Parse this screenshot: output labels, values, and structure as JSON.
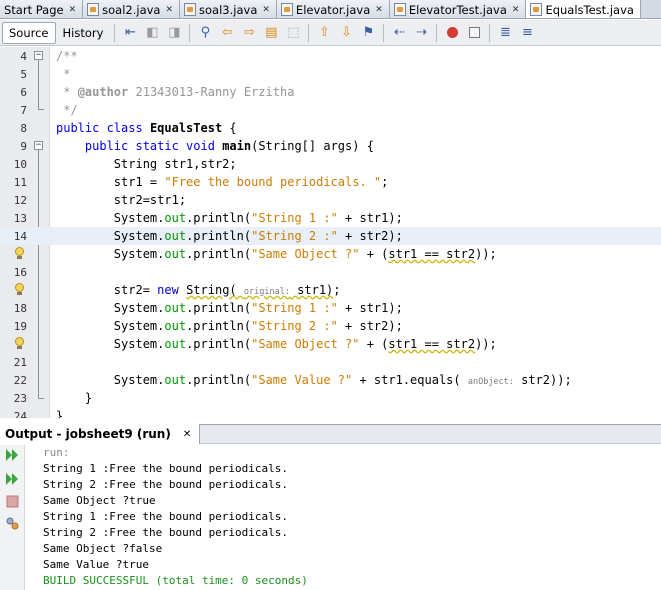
{
  "tabs": [
    {
      "label": "Start Page",
      "has_icon": false,
      "active": false
    },
    {
      "label": "soal2.java",
      "has_icon": true,
      "active": false
    },
    {
      "label": "soal3.java",
      "has_icon": true,
      "active": false
    },
    {
      "label": "Elevator.java",
      "has_icon": true,
      "active": false
    },
    {
      "label": "ElevatorTest.java",
      "has_icon": true,
      "active": false
    },
    {
      "label": "EqualsTest.java",
      "has_icon": true,
      "active": true
    }
  ],
  "toolbar": {
    "source_label": "Source",
    "history_label": "History"
  },
  "editor": {
    "line_numbers": [
      "4",
      "5",
      "6",
      "7",
      "8",
      "9",
      "10",
      "11",
      "12",
      "13",
      "14",
      "15",
      "16",
      "17",
      "18",
      "19",
      "20",
      "21",
      "22",
      "23",
      "24"
    ],
    "author_tag": "@author",
    "author_value": " 21343013-Ranny Erzitha",
    "strings": {
      "free": "\"Free the bound periodicals. \"",
      "s1": "\"String 1 :\"",
      "s2": "\"String 2 :\"",
      "same_obj": "\"Same Object ?\"",
      "same_val": "\"Same Value ?\""
    },
    "param_hints": {
      "original": "original:",
      "anObject": "anObject:"
    }
  },
  "output": {
    "tab_label": "Output - jobsheet9 (run)",
    "lines": [
      "run:",
      "String 1 :Free the bound periodicals.",
      "String 2 :Free the bound periodicals.",
      "Same Object ?true",
      "String 1 :Free the bound periodicals.",
      "String 2 :Free the bound periodicals.",
      "Same Object ?false",
      "Same Value ?true",
      "BUILD SUCCESSFUL (total time: 0 seconds)"
    ]
  },
  "colors": {
    "keyword": "#0000e6",
    "string": "#ce7b00",
    "comment": "#969696",
    "field": "#009900",
    "build_success": "#1a8f1a"
  }
}
